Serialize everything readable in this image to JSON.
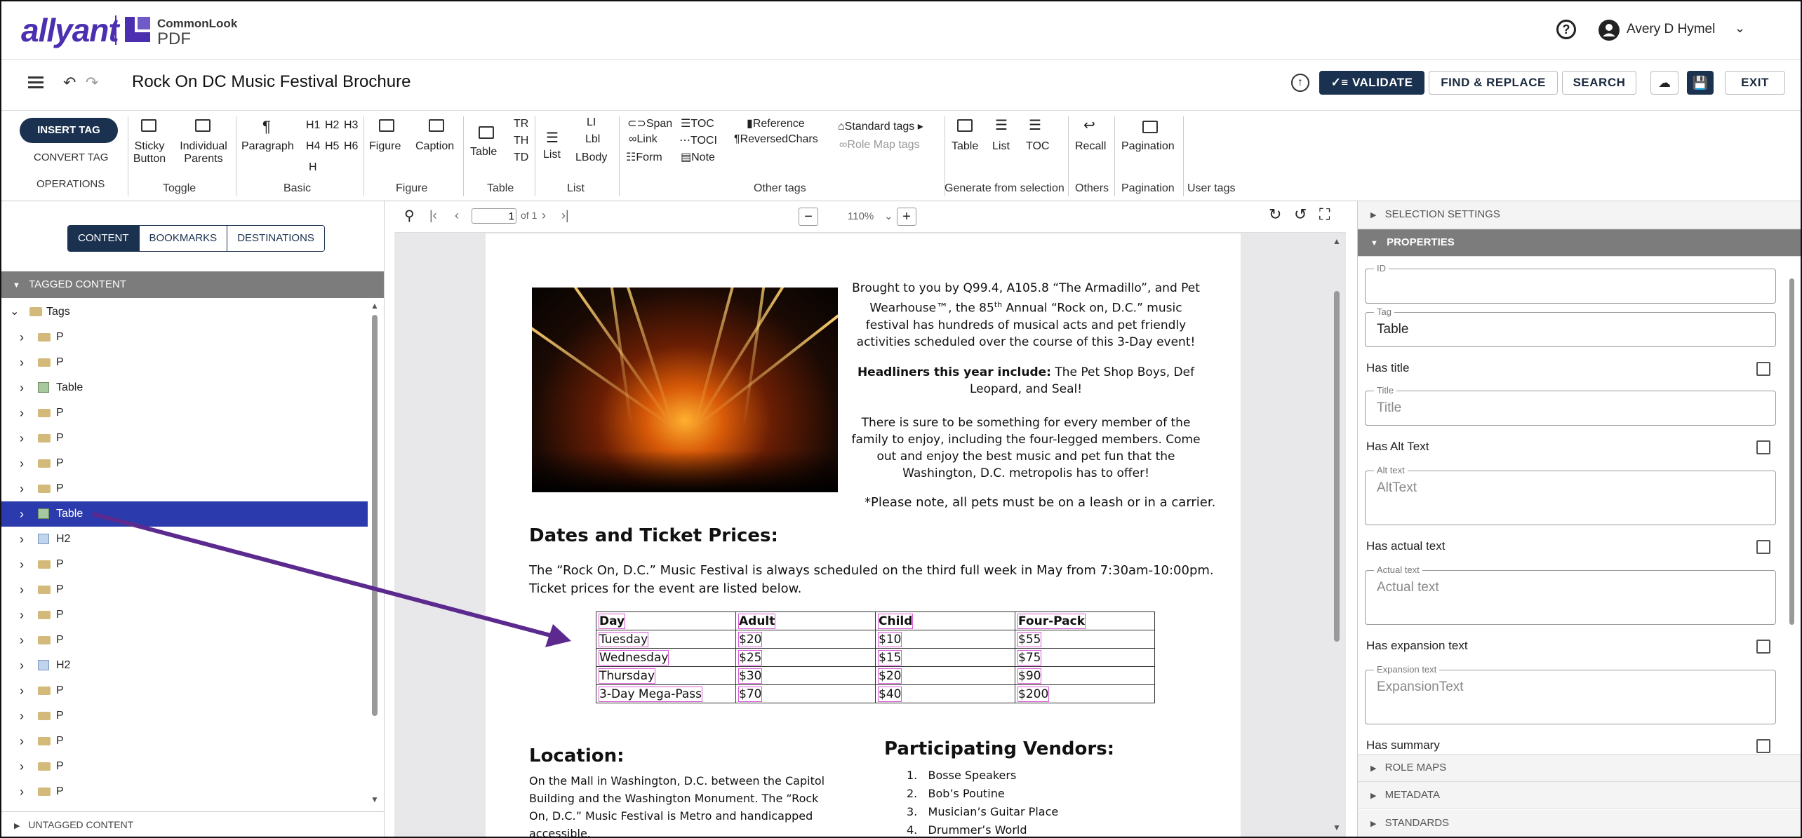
{
  "app": {
    "brand": "allyant",
    "product_line1": "CommonLook",
    "product_line2": "PDF",
    "user_name": "Avery D Hymel",
    "accent": "#1b3150"
  },
  "titlebar": {
    "doc_title": "Rock On DC Music Festival Brochure",
    "validate": "VALIDATE",
    "find_replace": "FIND & REPLACE",
    "search": "SEARCH",
    "exit": "EXIT"
  },
  "toolbar": {
    "insert_tag": "INSERT TAG",
    "convert_tag": "CONVERT TAG",
    "operations": "OPERATIONS",
    "sticky_button_1": "Sticky",
    "sticky_button_2": "Button",
    "individual_parents_1": "Individual",
    "individual_parents_2": "Parents",
    "group_toggle": "Toggle",
    "paragraph": "Paragraph",
    "h1": "H1",
    "h2": "H2",
    "h3": "H3",
    "h4": "H4",
    "h5": "H5",
    "h6": "H6",
    "h": "H",
    "group_basic": "Basic",
    "figure": "Figure",
    "caption": "Caption",
    "group_figure": "Figure",
    "table": "Table",
    "tr": "TR",
    "th": "TH",
    "td": "TD",
    "group_table": "Table",
    "list": "List",
    "li": "LI",
    "lbl": "Lbl",
    "lbody": "LBody",
    "group_list": "List",
    "span": "Span",
    "link": "Link",
    "form": "Form",
    "toc": "TOC",
    "toci": "TOCI",
    "note": "Note",
    "reference": "Reference",
    "reversedchars": "ReversedChars",
    "standard_tags": "Standard tags",
    "role_map_tags": "Role Map tags",
    "group_other": "Other tags",
    "gen_table": "Table",
    "gen_list": "List",
    "gen_toc": "TOC",
    "group_generate": "Generate from selection",
    "recall": "Recall",
    "group_others": "Others",
    "pagination": "Pagination",
    "group_pagination": "Pagination",
    "group_user": "User tags"
  },
  "left": {
    "tabs": [
      "CONTENT",
      "BOOKMARKS",
      "DESTINATIONS"
    ],
    "tagged_header": "TAGGED CONTENT",
    "root": "Tags",
    "items": [
      "P",
      "P",
      "Table",
      "P",
      "P",
      "P",
      "P",
      "Table",
      "H2",
      "P",
      "P",
      "P",
      "P",
      "H2",
      "P",
      "P",
      "P",
      "P",
      "P"
    ],
    "selected_index": 7,
    "untagged_header": "UNTAGGED CONTENT"
  },
  "viewer": {
    "page_value": "1",
    "page_of": "of 1",
    "zoom": "110%"
  },
  "doc": {
    "intro_l1": "Brought to you by Q99.4, A105.8 “The Armadillo”, and Pet",
    "intro_l2a": "Wearhouse™, the 85",
    "intro_sup": "th",
    "intro_l2b": " Annual “Rock on, D.C.” music",
    "intro_l3": "festival has hundreds of musical acts and pet friendly",
    "intro_l4": "activities scheduled over the course of this 3-Day event!",
    "headliners_bold": "Headliners this year include:",
    "headliners_rest": " The Pet Shop Boys, Def",
    "headliners_l2": "Leopard, and Seal!",
    "member_l1": "There is sure to be something for every member of the",
    "member_l2": "family to enjoy, including the four-legged members.  Come",
    "member_l3": "out and enjoy the best music and pet fun that the",
    "member_l4": "Washington, D.C. metropolis has to offer!",
    "note": "*Please note, all pets must be on a leash or in a carrier.",
    "dates_heading": "Dates and Ticket Prices:",
    "dates_l1": "The “Rock On, D.C.” Music Festival is always scheduled on the third full week in May from 7:30am-10:00pm.",
    "dates_l2": "Ticket prices for the event are listed below.",
    "table_header": [
      "Day",
      "Adult",
      "Child",
      "Four-Pack"
    ],
    "table_rows": [
      [
        "Tuesday",
        "$20",
        "$10",
        "$55"
      ],
      [
        "Wednesday",
        "$25",
        "$15",
        "$75"
      ],
      [
        "Thursday",
        "$30",
        "$20",
        "$90"
      ],
      [
        "3-Day Mega-Pass",
        "$70",
        "$40",
        "$200"
      ]
    ],
    "location_heading": "Location:",
    "location_l1": "On the Mall in Washington, D.C. between the Capitol",
    "location_l2": "Building and the Washington Monument.  The “Rock",
    "location_l3": "On, D.C.” Music Festival is Metro and handicapped",
    "location_l4": "accessible.",
    "vendors_heading": "Participating Vendors:",
    "vendors": [
      "Bosse Speakers",
      "Bob’s Poutine",
      "Musician’s Guitar Place",
      "Drummer’s World"
    ]
  },
  "right": {
    "selection_settings": "SELECTION SETTINGS",
    "properties": "PROPERTIES",
    "id_label": "ID",
    "tag_label": "Tag",
    "tag_value": "Table",
    "has_title": "Has title",
    "title_label": "Title",
    "title_ph": "Title",
    "has_alt": "Has Alt Text",
    "alt_label": "Alt text",
    "alt_ph": "AltText",
    "has_actual": "Has actual text",
    "actual_label": "Actual text",
    "actual_ph": "Actual text",
    "has_expansion": "Has expansion text",
    "expansion_label": "Expansion text",
    "expansion_ph": "ExpansionText",
    "has_summary": "Has summary",
    "role_maps": "ROLE MAPS",
    "metadata": "METADATA",
    "standards": "STANDARDS"
  }
}
